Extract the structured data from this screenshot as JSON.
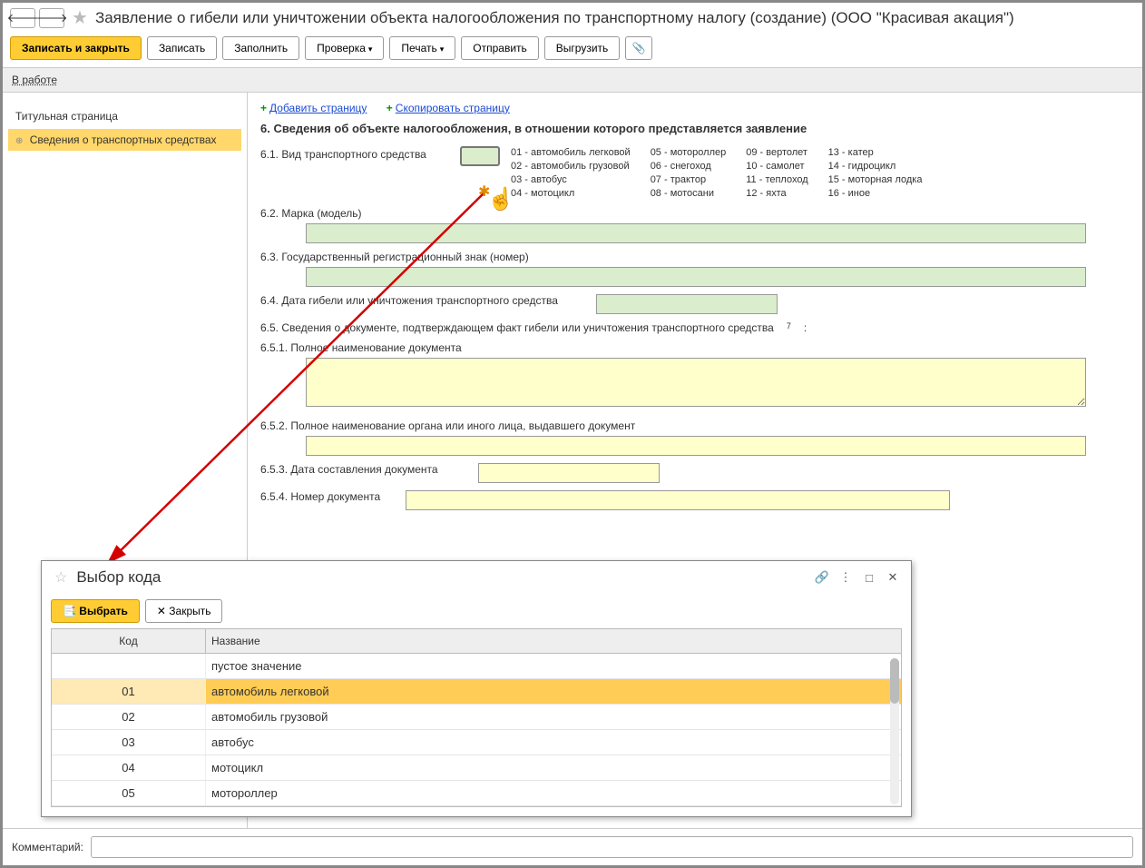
{
  "header": {
    "title": "Заявление о гибели или уничтожении объекта налогообложения по транспортному налогу (создание) (ООО \"Красивая акация\")"
  },
  "toolbar": {
    "save_close": "Записать и закрыть",
    "save": "Записать",
    "fill": "Заполнить",
    "check": "Проверка",
    "print": "Печать",
    "send": "Отправить",
    "export": "Выгрузить"
  },
  "status": {
    "text": "В работе"
  },
  "sidebar": {
    "item1": "Титульная страница",
    "item2": "Сведения о транспортных средствах"
  },
  "page_links": {
    "add": "Добавить страницу",
    "copy": "Скопировать страницу"
  },
  "section": {
    "heading": "6. Сведения об объекте налогообложения, в отношении которого представляется заявление",
    "l61": "6.1. Вид транспортного средства",
    "legend": {
      "c1r1": "01 - автомобиль легковой",
      "c1r2": "02 - автомобиль грузовой",
      "c1r3": "03 - автобус",
      "c1r4": "04 - мотоцикл",
      "c2r1": "05 - мотороллер",
      "c2r2": "06 - снегоход",
      "c2r3": "07 - трактор",
      "c2r4": "08 - мотосани",
      "c3r1": "09 - вертолет",
      "c3r2": "10 - самолет",
      "c3r3": "11 - теплоход",
      "c3r4": "12 - яхта",
      "c4r1": "13 - катер",
      "c4r2": "14 - гидроцикл",
      "c4r3": "15 - моторная лодка",
      "c4r4": "16 - иное"
    },
    "l62": "6.2. Марка (модель)",
    "l63": "6.3. Государственный регистрационный знак (номер)",
    "l64": "6.4. Дата гибели или уничтожения транспортного средства",
    "l65": "6.5. Сведения о документе, подтверждающем факт гибели или уничтожения транспортного средства",
    "sup7": "7",
    "colon": ":",
    "l651": "6.5.1. Полное наименование документа",
    "l652": "6.5.2. Полное наименование органа или иного лица, выдавшего документ",
    "l653": "6.5.3. Дата составления документа",
    "l654": "6.5.4. Номер документа"
  },
  "popup": {
    "title": "Выбор кода",
    "select": "Выбрать",
    "close": "Закрыть",
    "col1": "Код",
    "col2": "Название",
    "rows": [
      {
        "code": "",
        "name": "пустое значение"
      },
      {
        "code": "01",
        "name": "автомобиль легковой"
      },
      {
        "code": "02",
        "name": "автомобиль грузовой"
      },
      {
        "code": "03",
        "name": "автобус"
      },
      {
        "code": "04",
        "name": "мотоцикл"
      },
      {
        "code": "05",
        "name": "мотороллер"
      }
    ],
    "selected_index": 1
  },
  "footer": {
    "comment_label": "Комментарий:"
  }
}
